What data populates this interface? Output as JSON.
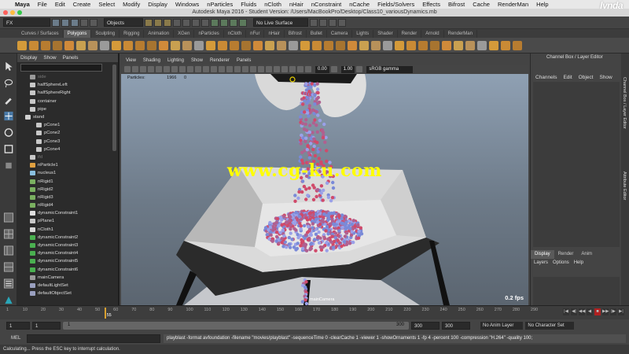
{
  "menubar": {
    "app": "Maya",
    "items": [
      "File",
      "Edit",
      "Create",
      "Select",
      "Modify",
      "Display",
      "Windows",
      "nParticles",
      "Fluids",
      "nCloth",
      "nHair",
      "nConstraint",
      "nCache",
      "Fields/Solvers",
      "Effects",
      "Bifrost",
      "Cache",
      "RenderMan",
      "Help"
    ],
    "watermark": "lynda"
  },
  "titlebar": {
    "title": "Autodesk Maya 2016 - Student Version: /Users/MacBookPro/Desktop/Class10_variousDynamics.mb"
  },
  "statusline": {
    "menuset": "FX",
    "objects": "Objects",
    "live_surface": "No Live Surface"
  },
  "shelf": {
    "tabs": [
      "Curves / Surfaces",
      "Polygons",
      "Sculpting",
      "Rigging",
      "Animation",
      "XGen",
      "nParticles",
      "nCloth",
      "nFur",
      "nHair",
      "Bifrost",
      "Bullet",
      "Camera",
      "Lights",
      "Shader",
      "Render",
      "Arnold",
      "RenderMan"
    ],
    "active_tab": "Polygons"
  },
  "outliner": {
    "menu": [
      "Display",
      "Show",
      "Panels"
    ],
    "items": [
      {
        "label": "side",
        "dim": true,
        "icon": "camera"
      },
      {
        "label": "halfSphereLeft",
        "icon": "mesh"
      },
      {
        "label": "halfSphereRight",
        "icon": "mesh"
      },
      {
        "label": "container",
        "icon": "mesh"
      },
      {
        "label": "pipe",
        "icon": "mesh"
      },
      {
        "label": "stand",
        "icon": "group"
      },
      {
        "label": "pCone1",
        "icon": "mesh"
      },
      {
        "label": "pCone2",
        "icon": "mesh"
      },
      {
        "label": "pCone3",
        "icon": "mesh"
      },
      {
        "label": "pCone4",
        "icon": "mesh"
      },
      {
        "label": "ifd",
        "dim": true,
        "icon": "mesh"
      },
      {
        "label": "nParticle1",
        "icon": "particle"
      },
      {
        "label": "nucleus1",
        "icon": "nucleus"
      },
      {
        "label": "nRigid1",
        "icon": "rigid"
      },
      {
        "label": "nRigid2",
        "icon": "rigid"
      },
      {
        "label": "nRigid3",
        "icon": "rigid"
      },
      {
        "label": "nRigid4",
        "icon": "rigid"
      },
      {
        "label": "dynamicConstraint1",
        "icon": "constraint"
      },
      {
        "label": "pPlane1",
        "icon": "mesh"
      },
      {
        "label": "nCloth1",
        "icon": "cloth"
      },
      {
        "label": "dynamicConstraint2",
        "icon": "constraint2"
      },
      {
        "label": "dynamicConstraint3",
        "icon": "constraint2"
      },
      {
        "label": "dynamicConstraint4",
        "icon": "constraint2"
      },
      {
        "label": "dynamicConstraint5",
        "icon": "constraint2"
      },
      {
        "label": "dynamicConstraint6",
        "icon": "constraint2"
      },
      {
        "label": "mainCamera",
        "icon": "camera"
      },
      {
        "label": "defaultLightSet",
        "icon": "set"
      },
      {
        "label": "defaultObjectSet",
        "icon": "set"
      }
    ]
  },
  "viewport": {
    "menu": [
      "View",
      "Shading",
      "Lighting",
      "Show",
      "Renderer",
      "Panels"
    ],
    "hud_particles_label": "Particles:",
    "hud_particles_value": "1966",
    "hud_particles_extra": "0",
    "exposure": "0.00",
    "gamma": "1.00",
    "color_space": "sRGB gamma",
    "camera": "mainCamera",
    "fps": "0.2 fps",
    "overlay_text": "www.cg-ku.com"
  },
  "channelbox": {
    "title": "Channel Box / Layer Editor",
    "menu": [
      "Channels",
      "Edit",
      "Object",
      "Show"
    ],
    "layer_tabs": [
      "Display",
      "Render",
      "Anim"
    ],
    "layer_menu": [
      "Layers",
      "Options",
      "Help"
    ],
    "side_tabs": [
      "Channel Box / Layer Editor",
      "Attribute Editor"
    ]
  },
  "timeslider": {
    "tick_labels": [
      "1",
      "10",
      "20",
      "30",
      "40",
      "50",
      "60",
      "70",
      "80",
      "90",
      "100",
      "110",
      "120",
      "130",
      "140",
      "150",
      "160",
      "170",
      "180",
      "190",
      "200",
      "210",
      "220",
      "230",
      "240",
      "250",
      "260",
      "270",
      "280",
      "290"
    ],
    "current_frame": "55",
    "range_start": 1,
    "range_end": 300,
    "current_value": 55
  },
  "rangeslider": {
    "start": "1",
    "playback_start": "1",
    "inner_start": "1",
    "inner_end": "300",
    "playback_end": "300",
    "end": "300",
    "anim_layer": "No Anim Layer",
    "character_set": "No Character Set"
  },
  "mel": {
    "label": "MEL",
    "output": "playblast -format avfoundation -filename \"movies/playblast\" -sequenceTime 0 -clearCache 1 -viewer 1 -showOrnaments 1 -fp 4 -percent 100 -compression \"H.264\" -quality 100;"
  },
  "helpline": {
    "text": "Calculating... Press the ESC key to interrupt calculation."
  },
  "colors": {
    "accent": "#5a5a5a",
    "viewport_top": "#8fa0b3",
    "timeslider_cursor": "#d9a130",
    "particle_red": "#d04a6a",
    "particle_blue": "#7a8ad8",
    "overlay_yellow": "#ffff00"
  }
}
